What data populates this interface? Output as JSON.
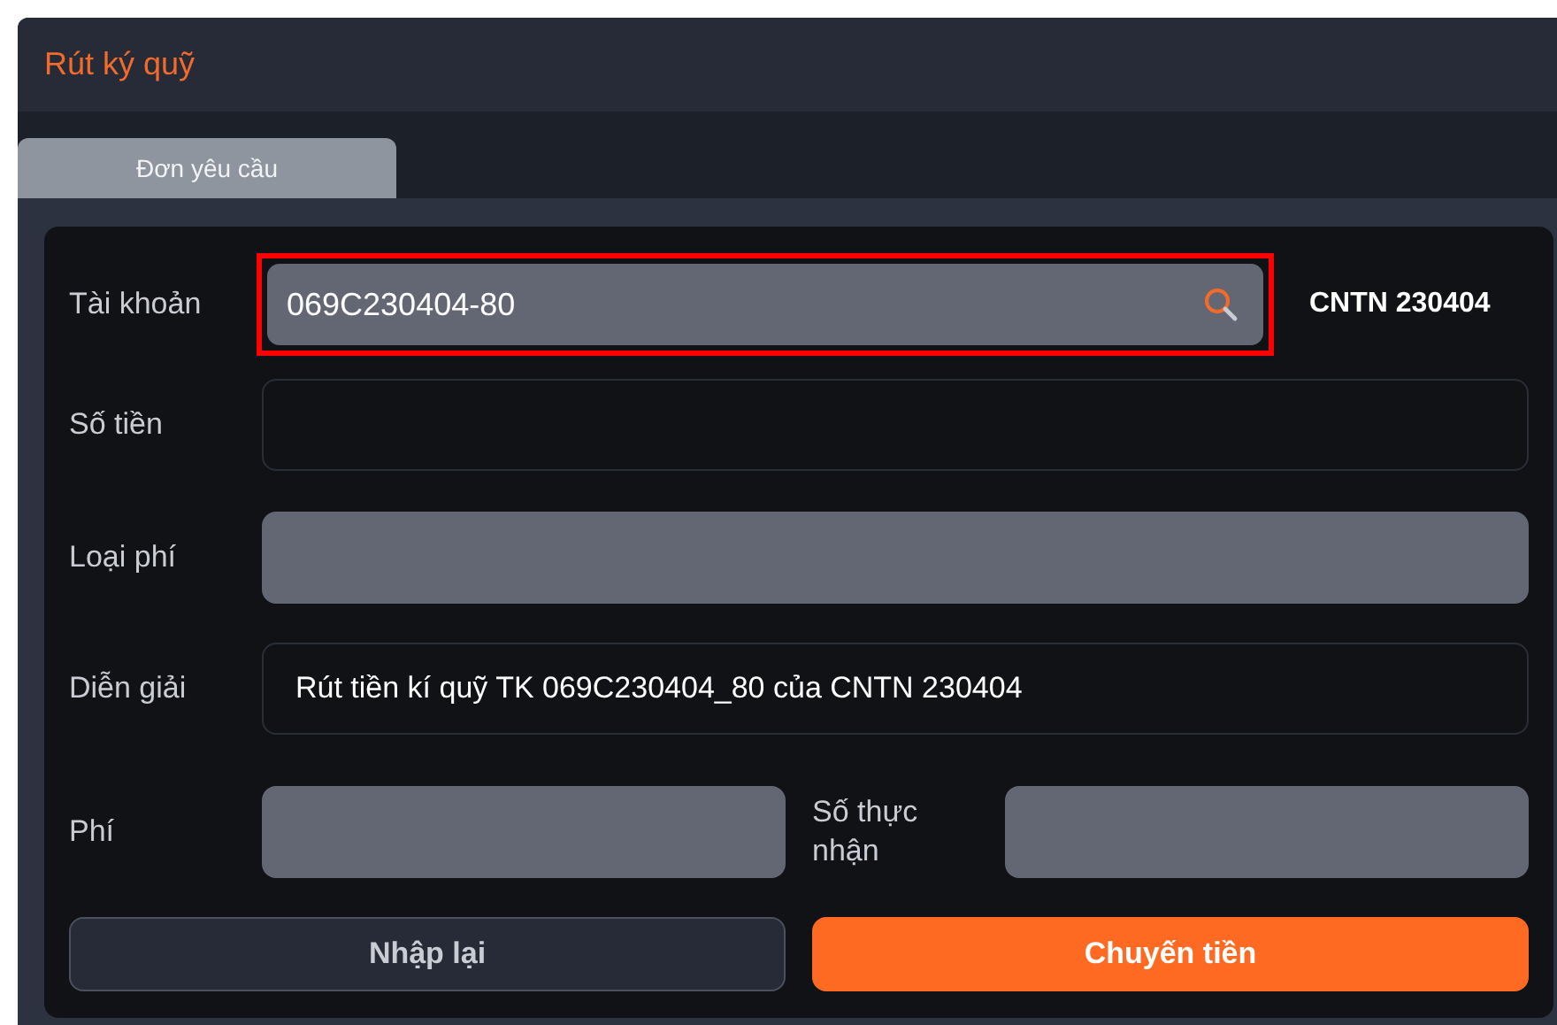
{
  "window": {
    "title": "Rút ký quỹ"
  },
  "tabs": [
    {
      "label": "Đơn yêu cầu",
      "selected": true
    }
  ],
  "form": {
    "account": {
      "label": "Tài khoản",
      "value": "069C230404-80",
      "highlighted": true,
      "owner": "CNTN 230404"
    },
    "fields": [
      {
        "label": "Số tiền",
        "kind": "text"
      },
      {
        "label": "Loại phí",
        "kind": "readonly"
      },
      {
        "label": "Diễn giải",
        "kind": "text",
        "value": "Rút tiền kí quỹ TK 069C230404_80 của CNTN 230404"
      }
    ],
    "fee_row": [
      {
        "label": "Phí",
        "kind": "readonly"
      },
      {
        "label": "Số thực nhận",
        "kind": "readonly"
      }
    ]
  },
  "buttons": [
    {
      "label": "Nhập lại",
      "kind": "secondary"
    },
    {
      "label": "Chuyến tiền",
      "kind": "primary"
    }
  ]
}
